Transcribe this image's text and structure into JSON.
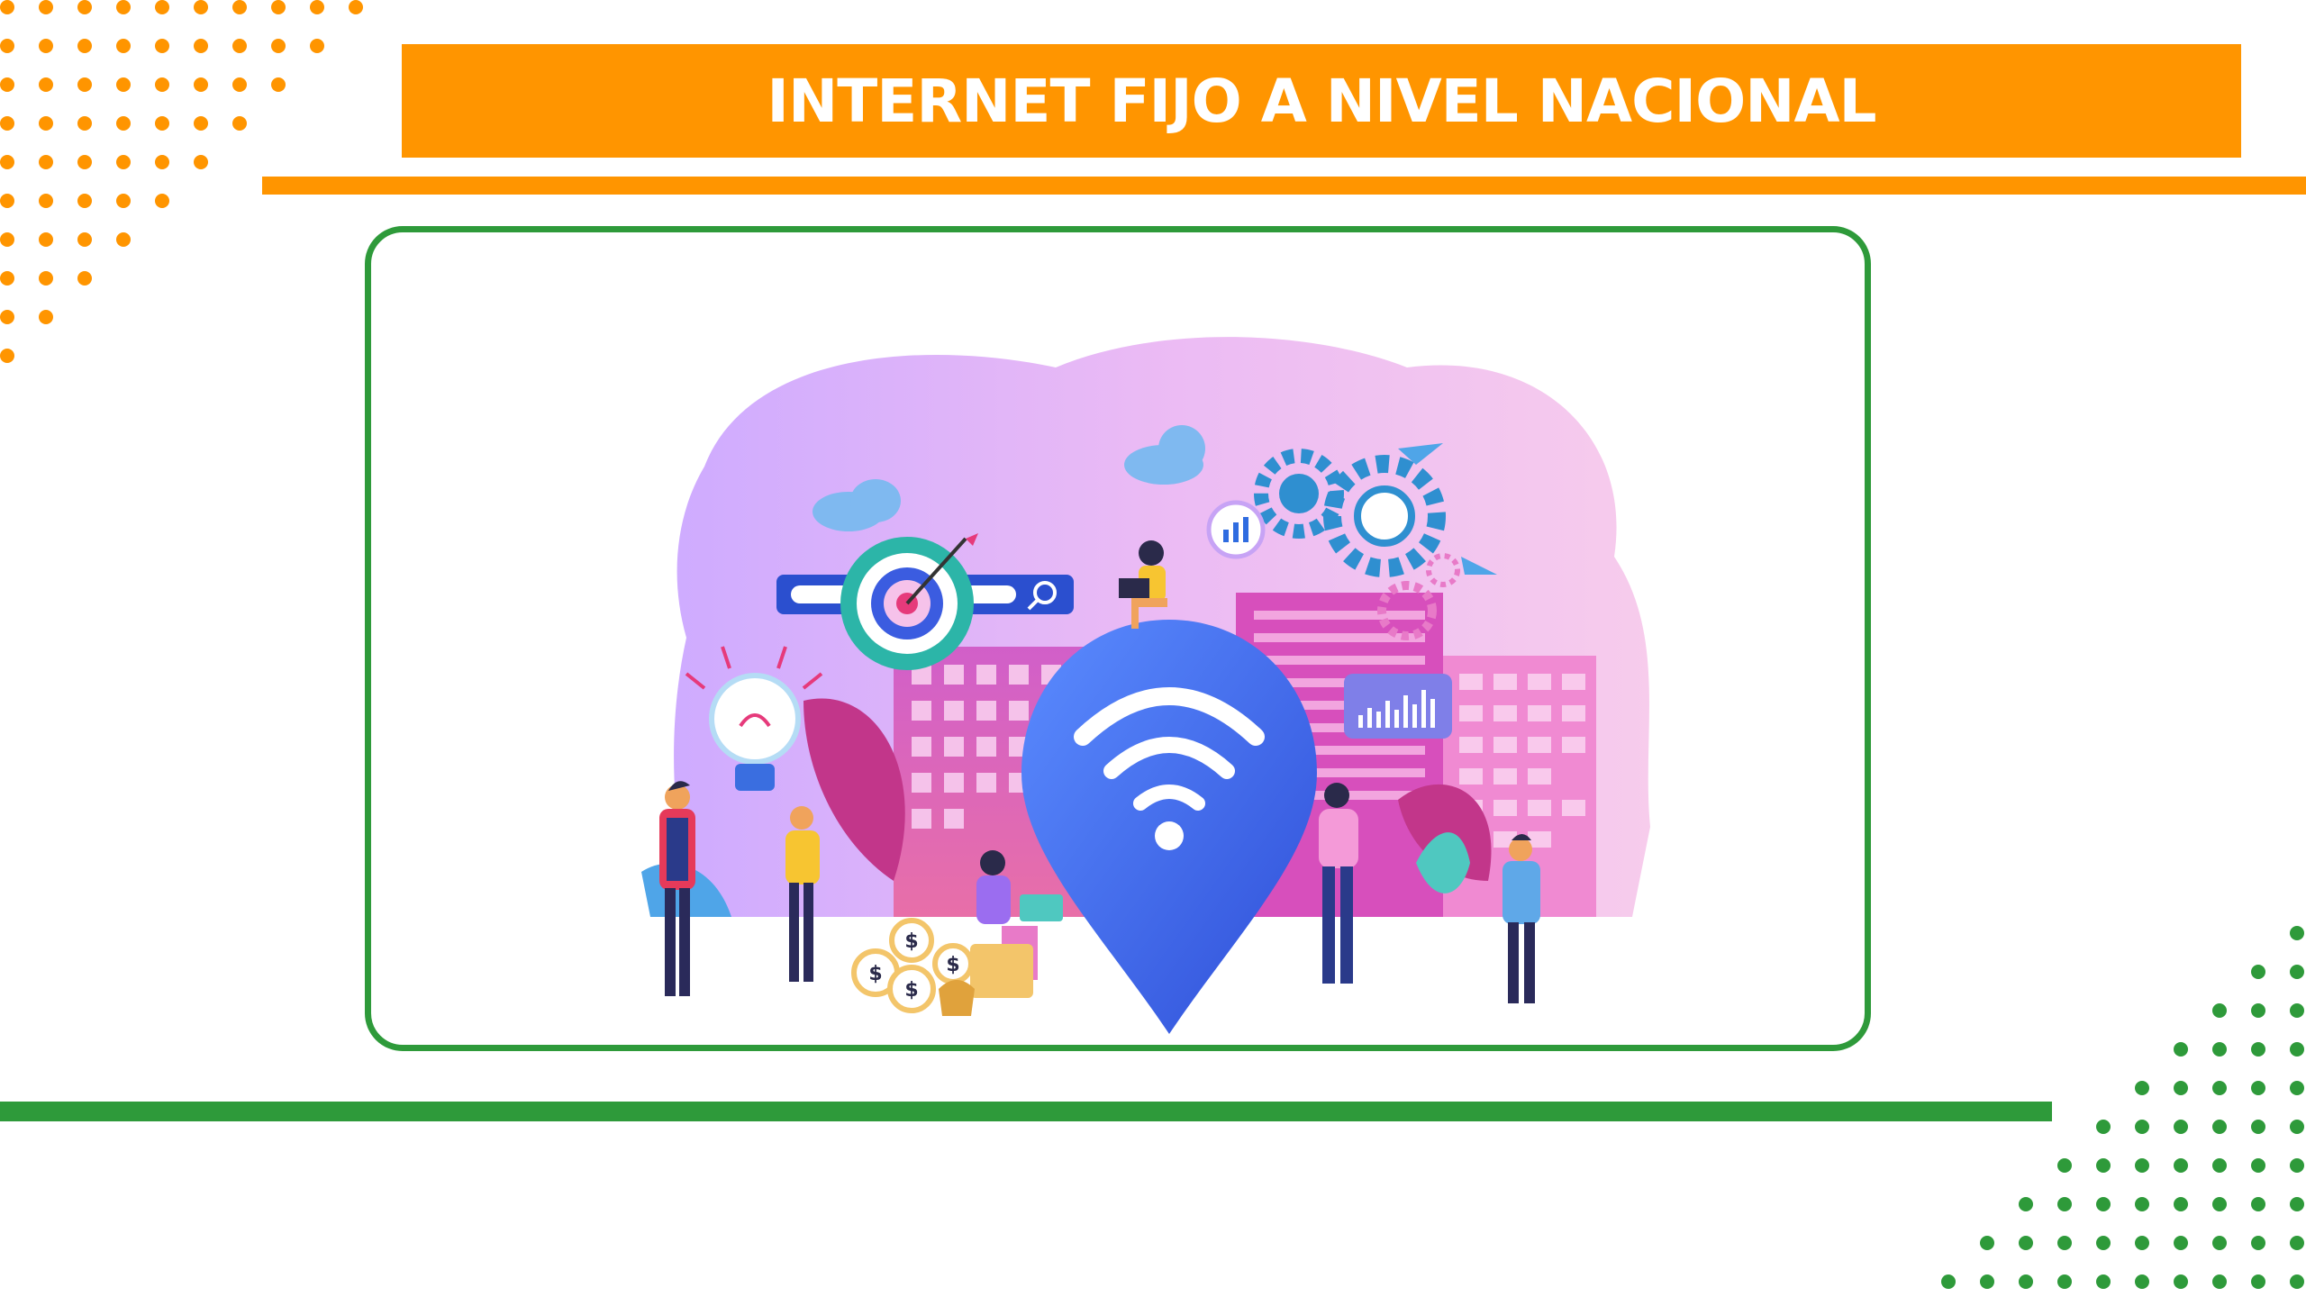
{
  "header": {
    "title": "INTERNET FIJO A NIVEL NACIONAL"
  },
  "colors": {
    "orange": "#ff9500",
    "green": "#2e9a3a",
    "white": "#ffffff",
    "pin_blue": "#3f6ef2",
    "illustration_pink": "#f1a7e6",
    "illustration_violet": "#b98cf0"
  },
  "illustration": {
    "subject": "wifi-location-pin-city-illustration",
    "icons": [
      "wifi-icon",
      "target-icon",
      "search-icon",
      "gear-icon",
      "lightbulb-icon",
      "dollar-coin-icon",
      "chart-icon",
      "paper-plane-icon"
    ]
  }
}
